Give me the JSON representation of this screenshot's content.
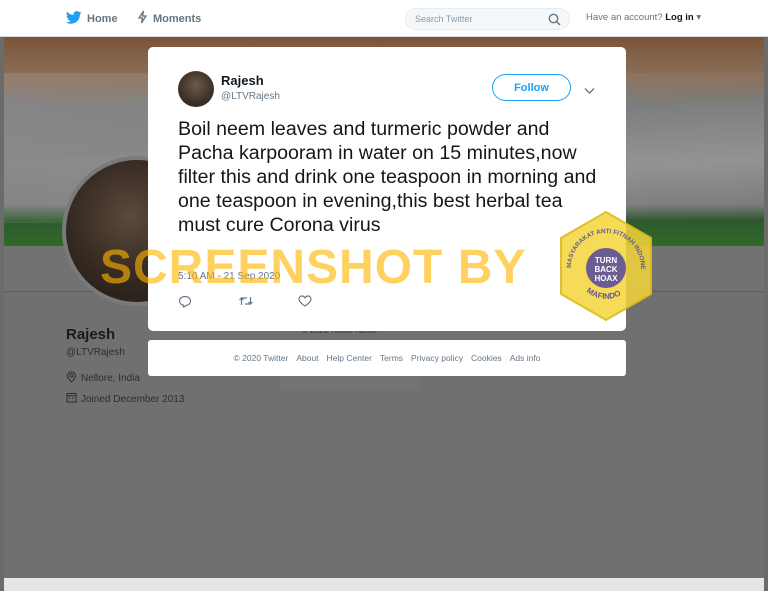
{
  "topnav": {
    "home_label": "Home",
    "moments_label": "Moments",
    "search_placeholder": "Search Twitter",
    "account_prompt": "Have an account?",
    "login_label": "Log in"
  },
  "profile": {
    "name": "Rajesh",
    "handle": "@LTVRajesh",
    "location": "Nellore, India",
    "joined": "Joined December 2013",
    "bg_footer": "© 2020 Twitter    About"
  },
  "tweet": {
    "author_name": "Rajesh",
    "author_handle": "@LTVRajesh",
    "follow_label": "Follow",
    "text": "Boil neem leaves and turmeric powder and Pacha karpooram in water on 15 minutes,now filter this and  drink one teaspoon in morning and one teaspoon in evening,this best herbal tea must cure Corona virus",
    "timestamp": "5:10 AM - 21 Sep 2020"
  },
  "footer": {
    "links": [
      "© 2020 Twitter",
      "About",
      "Help Center",
      "Terms",
      "Privacy policy",
      "Cookies",
      "Ads info"
    ]
  },
  "watermark": {
    "text": "SCREENSHOT BY",
    "seal_text": "MASYARAKAT ANTI FITNAH INDONESIA TURN BACK HOAX MAFINDO"
  },
  "colors": {
    "twitter_blue": "#1da1f2",
    "watermark_orange": "#ffb400",
    "seal_yellow": "#f3d53a",
    "seal_purple": "#5a4a9a"
  }
}
